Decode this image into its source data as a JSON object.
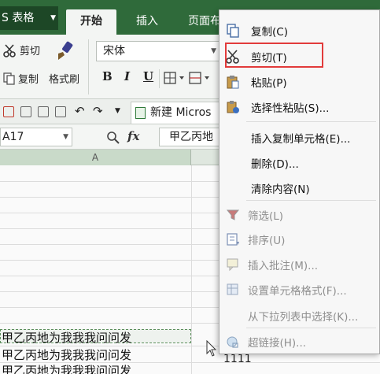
{
  "titlebar": {
    "app_button": "S 表格",
    "tabs": [
      "开始",
      "插入",
      "页面布"
    ]
  },
  "ribbon": {
    "cut_label": "剪切",
    "copy_label": "复制",
    "format_painter_label": "格式刷",
    "font_name": "宋体",
    "bold": "B",
    "italic": "I",
    "underline": "U"
  },
  "doc_tab": "新建 Micros",
  "formula_bar": {
    "name_box": "A17",
    "fx": "fx",
    "formula": "甲乙丙地"
  },
  "grid": {
    "column_header": "A",
    "cells": [
      "甲乙丙地为我我我问问发",
      "甲乙丙地为我我我问问发",
      "甲乙丙地为我我我问问发"
    ],
    "side_value": "1111"
  },
  "context_menu": {
    "items": [
      {
        "label": "复制(C)",
        "icon": "copy-icon",
        "enabled": true
      },
      {
        "label": "剪切(T)",
        "icon": "scissors-icon",
        "enabled": true
      },
      {
        "label": "粘贴(P)",
        "icon": "paste-icon",
        "enabled": true
      },
      {
        "label": "选择性粘贴(S)...",
        "icon": "paste-special-icon",
        "enabled": true
      },
      {
        "label": "插入复制单元格(E)...",
        "icon": "",
        "enabled": true
      },
      {
        "label": "删除(D)...",
        "icon": "",
        "enabled": true
      },
      {
        "label": "清除内容(N)",
        "icon": "",
        "enabled": true
      },
      {
        "label": "筛选(L)",
        "icon": "filter-icon",
        "enabled": false
      },
      {
        "label": "排序(U)",
        "icon": "sort-icon",
        "enabled": false
      },
      {
        "label": "插入批注(M)...",
        "icon": "comment-icon",
        "enabled": false
      },
      {
        "label": "设置单元格格式(F)...",
        "icon": "format-cells-icon",
        "enabled": false
      },
      {
        "label": "从下拉列表中选择(K)...",
        "icon": "",
        "enabled": false
      },
      {
        "label": "超链接(H)...",
        "icon": "hyperlink-icon",
        "enabled": false
      }
    ]
  },
  "colors": {
    "title_green": "#2f6a3a",
    "highlight_red": "#e23b3b"
  }
}
